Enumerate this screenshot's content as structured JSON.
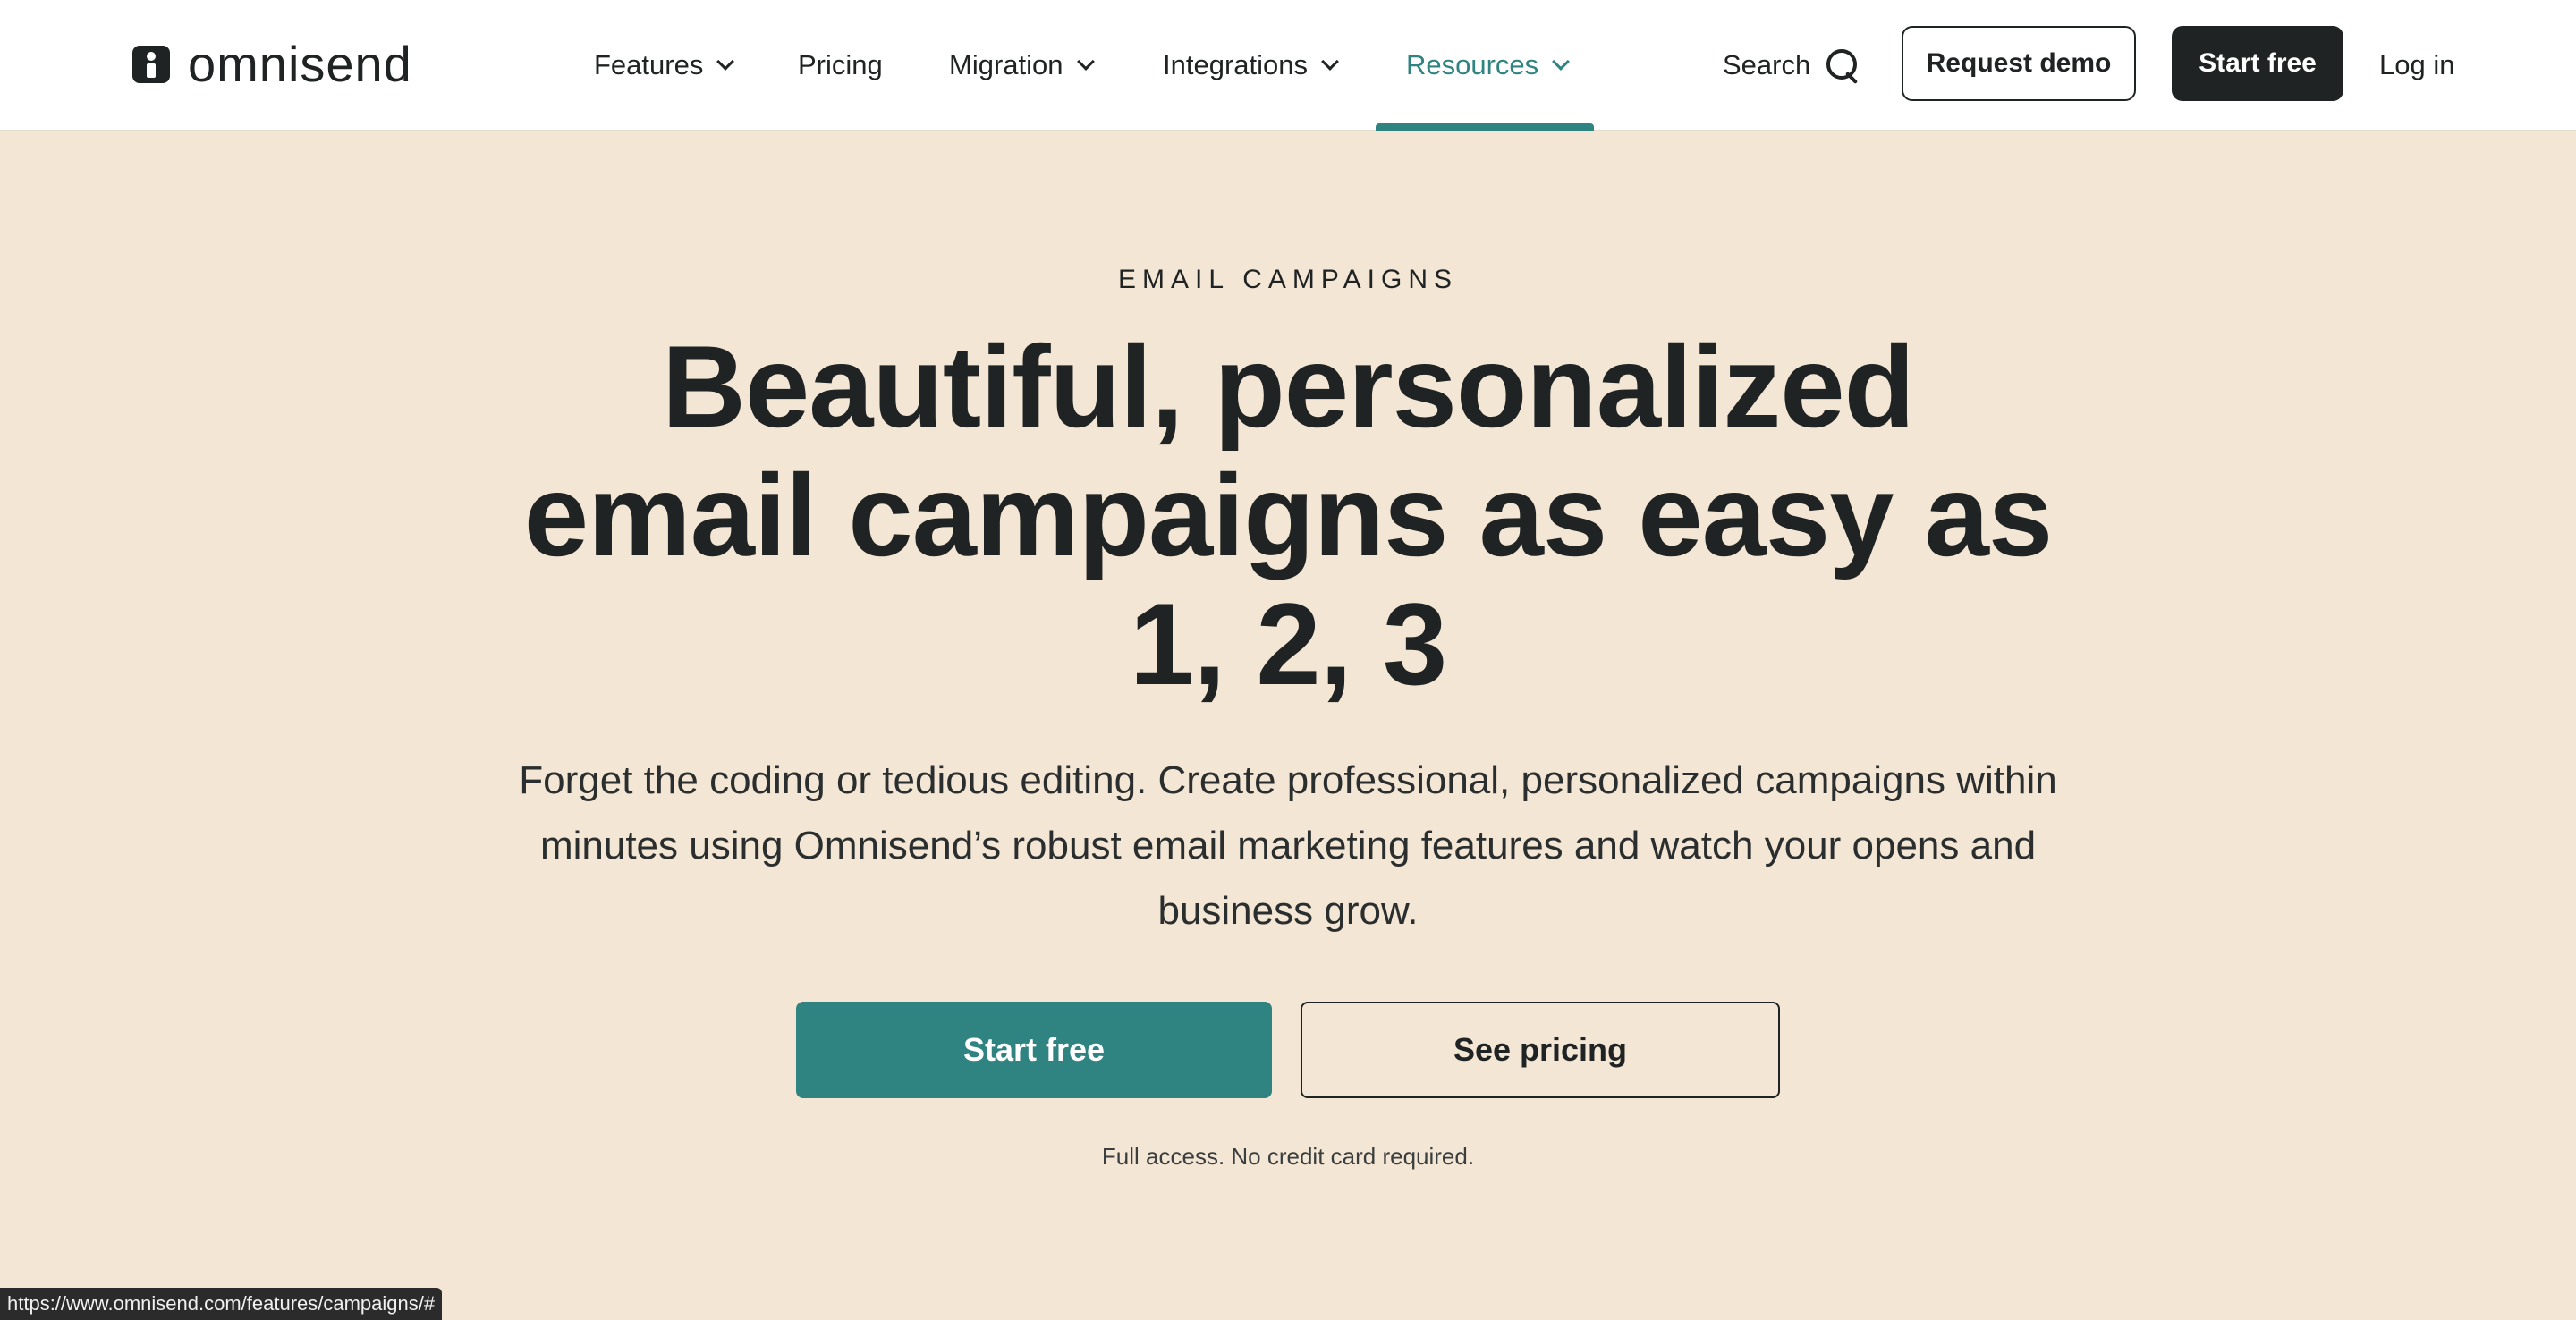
{
  "brand": {
    "name": "omnisend",
    "accent_color": "#2f8380",
    "dark_color": "#1f2323",
    "hero_bg": "#f3e6d4"
  },
  "nav": {
    "items": [
      {
        "label": "Features",
        "has_dropdown": true
      },
      {
        "label": "Pricing",
        "has_dropdown": false
      },
      {
        "label": "Migration",
        "has_dropdown": true
      },
      {
        "label": "Integrations",
        "has_dropdown": true
      },
      {
        "label": "Resources",
        "has_dropdown": true,
        "active": true
      }
    ],
    "search_label": "Search",
    "request_demo_label": "Request demo",
    "start_free_label": "Start free",
    "login_label": "Log in"
  },
  "hero": {
    "eyebrow": "EMAIL CAMPAIGNS",
    "headline_lines": [
      "Beautiful, personalized",
      "email campaigns as easy as",
      "1, 2, 3"
    ],
    "subtext": "Forget the coding or tedious editing. Create professional, personalized campaigns within minutes using Omnisend’s robust email marketing features and watch your opens and business grow.",
    "primary_cta": "Start free",
    "secondary_cta": "See pricing",
    "note": "Full access. No credit card required."
  },
  "status_bar": {
    "url": "https://www.omnisend.com/features/campaigns/#"
  }
}
